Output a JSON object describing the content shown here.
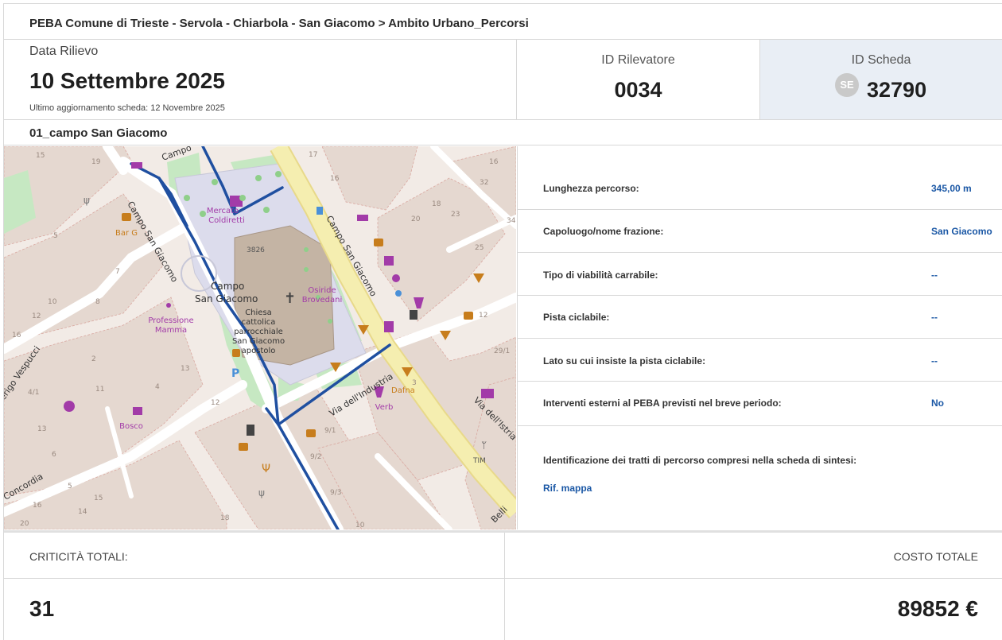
{
  "breadcrumb": "PEBA Comune di Trieste - Servola - Chiarbola - San Giacomo > Ambito Urbano_Percorsi",
  "survey": {
    "date_label": "Data Rilievo",
    "date_value": "10 Settembre 2025",
    "updated": "Ultimo aggiornamento scheda: 12 Novembre 2025"
  },
  "surveyor": {
    "label": "ID Rilevatore",
    "value": "0034"
  },
  "sheet": {
    "label": "ID Scheda",
    "badge": "SE",
    "value": "32790"
  },
  "route_title": "01_campo San Giacomo",
  "map": {
    "labels": {
      "campo1": "Campo",
      "campo_sg": "Campo San Giacomo",
      "campo_sg_diag": "Campo San Giacomo",
      "campo_sg_right": "Campo San Giacomo",
      "piazza_1": "Campo",
      "piazza_2": "San Giacomo",
      "mercato_1": "Mercato",
      "mercato_2": "Coldiretti",
      "chiesa_1": "Chiesa",
      "chiesa_2": "cattolica",
      "chiesa_3": "parrocchiale",
      "chiesa_4": "San Giacomo",
      "chiesa_5": "apostolo",
      "osiride_1": "Osiride",
      "osiride_2": "Brovedani",
      "industria": "Via dell'Industria",
      "istria": "Via dell'Istria",
      "vespucci": "erigo Vespucci",
      "concordia": "Concordia",
      "prof_1": "Professione",
      "prof_2": "Mamma",
      "dafna": "Dafna",
      "verb": "Verb",
      "bosco": "Bosco",
      "bar": "Bar G",
      "tim": "TIM",
      "belli": "Belli",
      "n3826": "3826",
      "n15": "15",
      "n19": "19",
      "n16": "16",
      "n17": "17",
      "n20": "20",
      "n23": "23",
      "n25": "25",
      "n18": "18",
      "n10": "10",
      "n8": "8",
      "n12": "12",
      "n13": "13",
      "n7": "7",
      "n2": "2",
      "n4": "4",
      "n4_1": "4/1",
      "n5": "5",
      "n11": "11",
      "n9_1": "9/1",
      "n9_2": "9/2",
      "n9_3": "9/3",
      "n29_1": "29/1",
      "n3": "3",
      "n34": "34",
      "n32": "32",
      "n6": "6",
      "n14": "14"
    }
  },
  "info": [
    {
      "key": "Lunghezza percorso:",
      "value": "345,00 m"
    },
    {
      "key": "Capoluogo/nome frazione:",
      "value": "San Giacomo"
    },
    {
      "key": "Tipo di viabilità carrabile:",
      "value": "--"
    },
    {
      "key": "Pista ciclabile:",
      "value": "--"
    },
    {
      "key": "Lato su cui insiste la pista ciclabile:",
      "value": "--"
    },
    {
      "key": "Interventi esterni al PEBA previsti nel breve periodo:",
      "value": "No"
    }
  ],
  "identification": {
    "label": "Identificazione dei tratti di percorso compresi nella scheda di sintesi:",
    "link": "Rif. mappa"
  },
  "totals": {
    "criticality_label": "CRITICITÀ TOTALI:",
    "criticality_value": "31",
    "cost_label": "COSTO TOTALE",
    "cost_value": "89852 €"
  },
  "colors": {
    "link": "#1a57a5",
    "route": "#1f4fa0",
    "sheet_bg": "#e9eef5",
    "road_yellow": "#f5eeb0",
    "poi": "#c77d1c",
    "shop": "#a23ba8"
  }
}
